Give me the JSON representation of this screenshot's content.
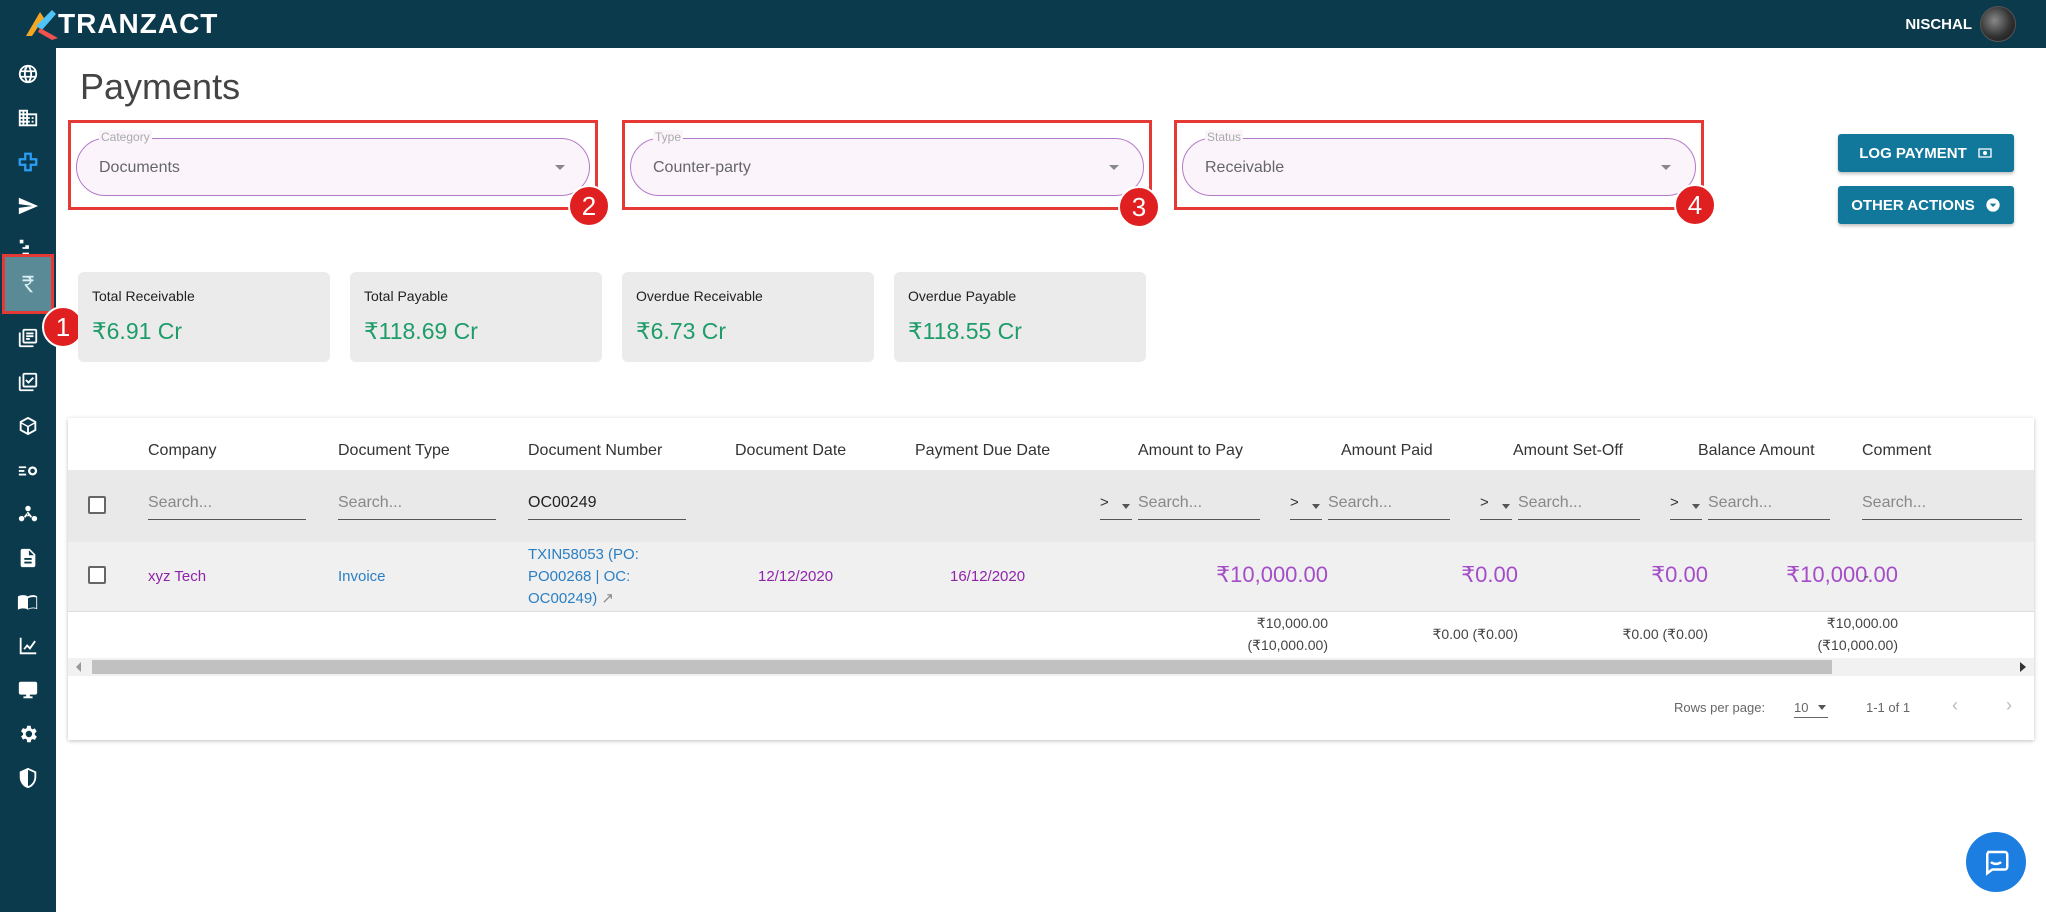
{
  "app": {
    "brand": "TRANZACT",
    "user": "NISCHAL"
  },
  "sidebar": {
    "icons": [
      "globe-icon",
      "building-icon",
      "plus-icon",
      "send-icon",
      "hierarchy-icon",
      "rupee-icon",
      "documents-icon",
      "checklist-icon",
      "cube-icon",
      "settings-flow-icon",
      "network-icon",
      "file-icon",
      "book-icon",
      "chart-icon",
      "monitor-icon",
      "gear-icon",
      "shield-icon"
    ],
    "active": "rupee-icon"
  },
  "page": {
    "title": "Payments"
  },
  "filters": {
    "category": {
      "label": "Category",
      "value": "Documents"
    },
    "type": {
      "label": "Type",
      "value": "Counter-party"
    },
    "status": {
      "label": "Status",
      "value": "Receivable"
    }
  },
  "callouts": [
    "1",
    "2",
    "3",
    "4"
  ],
  "actions": {
    "log_payment": "LOG PAYMENT",
    "other_actions": "OTHER ACTIONS"
  },
  "summary": [
    {
      "title": "Total Receivable",
      "value": "₹6.91 Cr"
    },
    {
      "title": "Total Payable",
      "value": "₹118.69 Cr"
    },
    {
      "title": "Overdue Receivable",
      "value": "₹6.73 Cr"
    },
    {
      "title": "Overdue Payable",
      "value": "₹118.55 Cr"
    }
  ],
  "table": {
    "columns": [
      "Company",
      "Document Type",
      "Document Number",
      "Document Date",
      "Payment Due Date",
      "Amount to Pay",
      "Amount Paid",
      "Amount Set-Off",
      "Balance Amount",
      "Comment"
    ],
    "search_placeholder": "Search...",
    "document_number_filter": "OC00249",
    "operator": ">",
    "rows": [
      {
        "company": "xyz Tech",
        "document_type": "Invoice",
        "document_number_lines": [
          "TXIN58053 (PO:",
          "PO00268 | OC:",
          "OC00249)"
        ],
        "document_date": "12/12/2020",
        "payment_due_date": "16/12/2020",
        "amount_to_pay": "₹10,000.00",
        "amount_paid": "₹0.00",
        "amount_set_off": "₹0.00",
        "balance_amount": "₹10,000.00",
        "comment": "-"
      }
    ],
    "totals": {
      "amount_to_pay": [
        "₹10,000.00",
        "(₹10,000.00)"
      ],
      "amount_paid": "₹0.00 (₹0.00)",
      "amount_set_off": "₹0.00 (₹0.00)",
      "balance_amount": [
        "₹10,000.00",
        "(₹10,000.00)"
      ]
    },
    "pagination": {
      "rows_per_page_label": "Rows per page:",
      "rows_per_page": "10",
      "range": "1-1 of 1"
    }
  },
  "colors": {
    "topbar": "#0b3a4d",
    "accent": "#12789b",
    "amount": "#a44dc8",
    "summary_value": "#1e9c6a",
    "callout": "#e02020"
  }
}
